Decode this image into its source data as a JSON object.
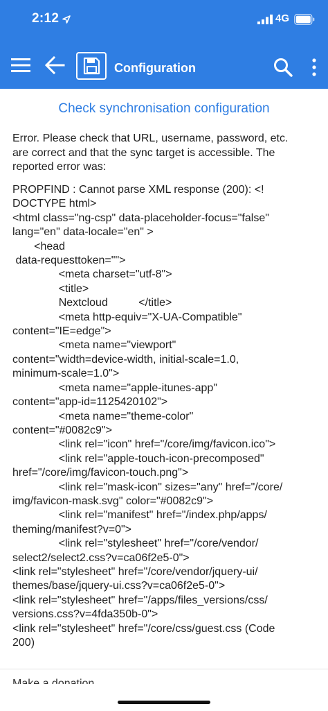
{
  "status_bar": {
    "time": "2:12",
    "network": "4G",
    "icons": [
      "location-icon",
      "signal-icon",
      "battery-icon"
    ]
  },
  "toolbar": {
    "title": "Configuration",
    "icons": [
      "menu-icon",
      "back-arrow-icon",
      "save-icon",
      "search-icon",
      "more-vertical-icon"
    ],
    "color": "#2f7ee3"
  },
  "main": {
    "check_link": "Check synchronisation configuration",
    "error_intro": "Error. Please check that URL, username, password, etc.\nare correct and that the sync target is accessible. The\nreported error was:",
    "error_detail": "PROPFIND : Cannot parse XML response (200): <!\nDOCTYPE html>\n<html class=\"ng-csp\" data-placeholder-focus=\"false\"\nlang=\"en\" data-locale=\"en\" >\n       <head\n data-requesttoken=\"\">\n               <meta charset=\"utf-8\">\n               <title>\n               Nextcloud          </title>\n               <meta http-equiv=\"X-UA-Compatible\"\ncontent=\"IE=edge\">\n               <meta name=\"viewport\"\ncontent=\"width=device-width, initial-scale=1.0,\nminimum-scale=1.0\">\n               <meta name=\"apple-itunes-app\"\ncontent=\"app-id=1125420102\">\n               <meta name=\"theme-color\"\ncontent=\"#0082c9\">\n               <link rel=\"icon\" href=\"/core/img/favicon.ico\">\n               <link rel=\"apple-touch-icon-precomposed\"\nhref=\"/core/img/favicon-touch.png\">\n               <link rel=\"mask-icon\" sizes=\"any\" href=\"/core/\nimg/favicon-mask.svg\" color=\"#0082c9\">\n               <link rel=\"manifest\" href=\"/index.php/apps/\ntheming/manifest?v=0\">\n               <link rel=\"stylesheet\" href=\"/core/vendor/\nselect2/select2.css?v=ca06f2e5-0\">\n<link rel=\"stylesheet\" href=\"/core/vendor/jquery-ui/\nthemes/base/jquery-ui.css?v=ca06f2e5-0\">\n<link rel=\"stylesheet\" href=\"/apps/files_versions/css/\nversions.css?v=4fda350b-0\">\n<link rel=\"stylesheet\" href=\"/core/css/guest.css (Code\n200)",
    "donate_link": "Make a donation"
  }
}
